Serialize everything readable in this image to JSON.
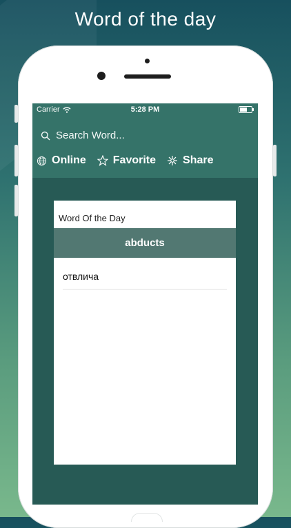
{
  "headline": "Word of the day",
  "status_bar": {
    "carrier": "Carrier",
    "time": "5:28 PM",
    "battery_level": 0.6
  },
  "search": {
    "placeholder": "Search Word...",
    "icon": "search-icon"
  },
  "toolbar": {
    "online_label": "Online",
    "favorite_label": "Favorite",
    "share_label": "Share"
  },
  "card": {
    "title": "Word Of the Day",
    "word": "abducts",
    "translation": "отвлича"
  },
  "colors": {
    "header": "#357369",
    "screen_bg": "#275a55",
    "word_band": "#527872",
    "background_top": "#17505e",
    "background_bottom": "#79b88c"
  }
}
